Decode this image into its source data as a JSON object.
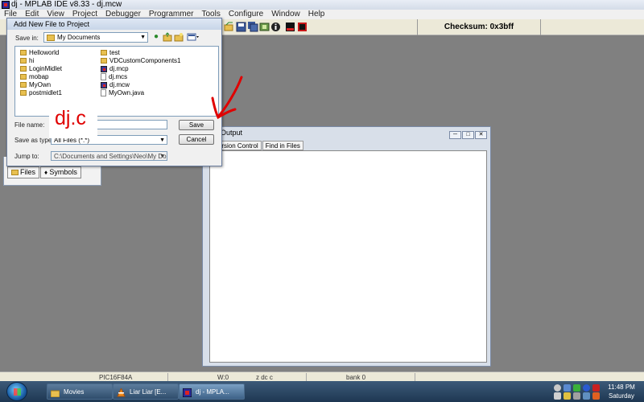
{
  "window": {
    "title": "dj - MPLAB IDE v8.33 - dj.mcw"
  },
  "menu": [
    "File",
    "Edit",
    "View",
    "Project",
    "Debugger",
    "Programmer",
    "Tools",
    "Configure",
    "Window",
    "Help"
  ],
  "toolbar": {
    "checksum": "Checksum:  0x3bff"
  },
  "dialog": {
    "title": "Add New File to Project",
    "save_in_label": "Save in:",
    "save_in_value": "My Documents",
    "files_col1": [
      {
        "name": "Helloworld",
        "kind": "folder"
      },
      {
        "name": "hi",
        "kind": "folder"
      },
      {
        "name": "LoginMidlet",
        "kind": "folder"
      },
      {
        "name": "mobap",
        "kind": "folder"
      },
      {
        "name": "MyOwn",
        "kind": "folder"
      },
      {
        "name": "postmidlet1",
        "kind": "folder"
      }
    ],
    "files_col2": [
      {
        "name": "test",
        "kind": "folder"
      },
      {
        "name": "VDCustomComponents1",
        "kind": "folder"
      },
      {
        "name": "dj.mcp",
        "kind": "mplab"
      },
      {
        "name": "dj.mcs",
        "kind": "doc"
      },
      {
        "name": "dj.mcw",
        "kind": "mplab"
      },
      {
        "name": "MyOwn.java",
        "kind": "doc"
      }
    ],
    "file_name_label": "File name:",
    "file_name_value": "dj.c",
    "save_as_type_label": "Save as type:",
    "save_as_type_value": "All Files (*.*)",
    "jump_to_label": "Jump to:",
    "jump_to_value": "C:\\Documents and Settings\\Neo\\My Docum",
    "save_button": "Save",
    "cancel_button": "Cancel"
  },
  "project_window": {
    "tabs": [
      "Files",
      "Symbols"
    ]
  },
  "output_window": {
    "title": "Output",
    "tabs": [
      "Version Control",
      "Find in Files"
    ]
  },
  "statusbar": {
    "device": "PIC16F84A",
    "w": "W:0",
    "flags": "z dc c",
    "bank": "bank 0"
  },
  "taskbar": {
    "tasks": [
      "Movies",
      "Liar Liar [E...",
      "dj - MPLA..."
    ],
    "time": "11:48 PM",
    "day": "Saturday"
  },
  "colors": {
    "annotation": "#e00000",
    "workspace": "#808080"
  }
}
